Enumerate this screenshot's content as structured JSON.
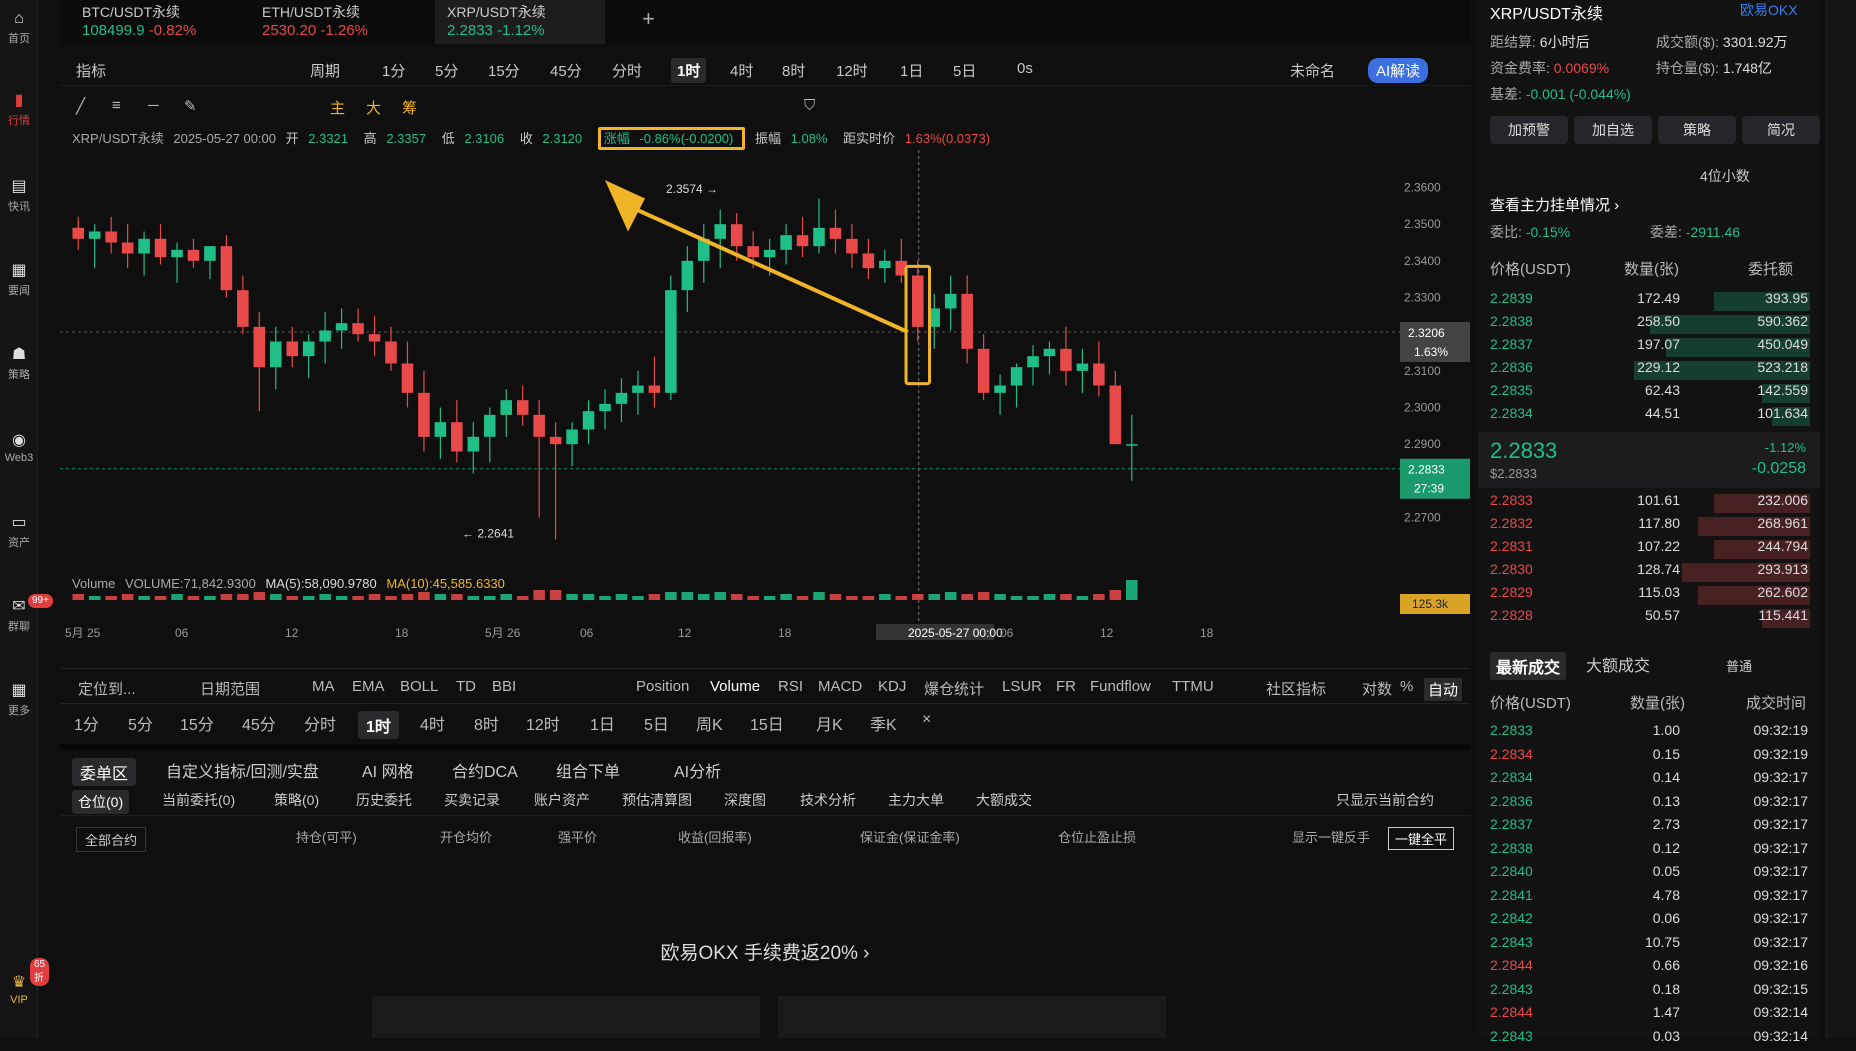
{
  "leftbar": {
    "items": [
      {
        "label": "首页",
        "icon": "home-icon"
      },
      {
        "label": "行情",
        "icon": "chart-bar-icon"
      },
      {
        "label": "快讯",
        "icon": "news-icon"
      },
      {
        "label": "要闻",
        "icon": "document-icon"
      },
      {
        "label": "策略",
        "icon": "robot-icon"
      },
      {
        "label": "Web3",
        "icon": "web3-icon"
      },
      {
        "label": "资产",
        "icon": "wallet-icon"
      },
      {
        "label": "群聊",
        "icon": "chat-icon"
      },
      {
        "label": "更多",
        "icon": "grid-icon"
      },
      {
        "label": "VIP",
        "icon": "vip-icon"
      }
    ],
    "chat_badge": "99+",
    "vip_badge": "65折"
  },
  "tabs": [
    {
      "name": "BTC/USDT永续",
      "price": "108499.9",
      "change": "-0.82%"
    },
    {
      "name": "ETH/USDT永续",
      "price": "2530.20",
      "change": "-1.26%"
    },
    {
      "name": "XRP/USDT永续",
      "price": "2.2833",
      "change": "-1.12%"
    }
  ],
  "add_tab": "+",
  "toolbar1": {
    "indicator": "指标",
    "period": "周期",
    "intervals": [
      "1分",
      "5分",
      "15分",
      "45分",
      "分时",
      "1时",
      "4时",
      "8时",
      "12时",
      "1日",
      "5日"
    ],
    "active_interval": "1时",
    "os": "0s",
    "unnamed": "未命名",
    "ai": "AI解读"
  },
  "toolbar2": {
    "labels": [
      "主",
      "大",
      "筹"
    ]
  },
  "chartinfo": {
    "symbol": "XRP/USDT永续",
    "datetime": "2025-05-27 00:00",
    "open_lbl": "开",
    "open": "2.3321",
    "high_lbl": "高",
    "high": "2.3357",
    "low_lbl": "低",
    "low": "2.3106",
    "close_lbl": "收",
    "close": "2.3120",
    "chg_lbl": "涨幅",
    "chg": "-0.86%(-0.0200)",
    "amp_lbl": "振幅",
    "amp": "1.08%",
    "dist_lbl": "距实时价",
    "dist": "1.63%(0.0373)"
  },
  "volume_info": {
    "label": "Volume",
    "volume": "VOLUME:71,842.9300",
    "ma5": "MA(5):58,090.9780",
    "ma10": "MA(10):45,585.6330"
  },
  "chart_data": {
    "type": "candlestick",
    "ylim": [
      2.26,
      2.37
    ],
    "yticks": [
      "2.3600",
      "2.3500",
      "2.3400",
      "2.3300",
      "2.3200",
      "2.3100",
      "2.3000",
      "2.2900",
      "2.2800",
      "2.2700"
    ],
    "xticks": [
      "5月 25",
      "06",
      "12",
      "18",
      "5月 26",
      "06",
      "12",
      "18",
      "2025-05-27 00:00",
      "06",
      "12",
      "18"
    ],
    "annotations": {
      "high": "2.3574",
      "low": "2.2641"
    },
    "crosshair_price": "2.3206",
    "crosshair_pct": "1.63%",
    "last_price": "2.2833",
    "countdown": "27:39",
    "volume_axis": "125.3k",
    "candles": [
      [
        2.349,
        2.352,
        2.343,
        2.346
      ],
      [
        2.346,
        2.35,
        2.338,
        2.348
      ],
      [
        2.348,
        2.352,
        2.342,
        2.345
      ],
      [
        2.345,
        2.35,
        2.338,
        2.342
      ],
      [
        2.342,
        2.348,
        2.336,
        2.346
      ],
      [
        2.346,
        2.35,
        2.339,
        2.341
      ],
      [
        2.341,
        2.345,
        2.334,
        2.343
      ],
      [
        2.343,
        2.346,
        2.338,
        2.34
      ],
      [
        2.34,
        2.344,
        2.335,
        2.344
      ],
      [
        2.344,
        2.347,
        2.33,
        2.332
      ],
      [
        2.332,
        2.336,
        2.32,
        2.322
      ],
      [
        2.322,
        2.326,
        2.299,
        2.311
      ],
      [
        2.311,
        2.322,
        2.305,
        2.318
      ],
      [
        2.318,
        2.322,
        2.311,
        2.314
      ],
      [
        2.314,
        2.32,
        2.308,
        2.318
      ],
      [
        2.318,
        2.326,
        2.312,
        2.321
      ],
      [
        2.321,
        2.327,
        2.316,
        2.323
      ],
      [
        2.323,
        2.327,
        2.318,
        2.32
      ],
      [
        2.32,
        2.325,
        2.314,
        2.318
      ],
      [
        2.318,
        2.322,
        2.31,
        2.312
      ],
      [
        2.312,
        2.318,
        2.3,
        2.304
      ],
      [
        2.304,
        2.31,
        2.288,
        2.292
      ],
      [
        2.292,
        2.3,
        2.286,
        2.296
      ],
      [
        2.296,
        2.302,
        2.285,
        2.288
      ],
      [
        2.288,
        2.296,
        2.282,
        2.292
      ],
      [
        2.292,
        2.3,
        2.285,
        2.298
      ],
      [
        2.298,
        2.305,
        2.292,
        2.302
      ],
      [
        2.302,
        2.306,
        2.295,
        2.298
      ],
      [
        2.298,
        2.302,
        2.27,
        2.292
      ],
      [
        2.292,
        2.296,
        2.264,
        2.29
      ],
      [
        2.29,
        2.296,
        2.284,
        2.294
      ],
      [
        2.294,
        2.302,
        2.29,
        2.299
      ],
      [
        2.299,
        2.305,
        2.294,
        2.301
      ],
      [
        2.301,
        2.308,
        2.296,
        2.304
      ],
      [
        2.304,
        2.31,
        2.298,
        2.306
      ],
      [
        2.306,
        2.314,
        2.3,
        2.304
      ],
      [
        2.304,
        2.336,
        2.302,
        2.332
      ],
      [
        2.332,
        2.344,
        2.326,
        2.34
      ],
      [
        2.34,
        2.35,
        2.334,
        2.346
      ],
      [
        2.346,
        2.354,
        2.338,
        2.35
      ],
      [
        2.35,
        2.353,
        2.34,
        2.344
      ],
      [
        2.344,
        2.348,
        2.338,
        2.341
      ],
      [
        2.341,
        2.346,
        2.336,
        2.343
      ],
      [
        2.343,
        2.35,
        2.339,
        2.347
      ],
      [
        2.347,
        2.352,
        2.341,
        2.344
      ],
      [
        2.344,
        2.357,
        2.342,
        2.349
      ],
      [
        2.349,
        2.354,
        2.342,
        2.346
      ],
      [
        2.346,
        2.35,
        2.338,
        2.342
      ],
      [
        2.342,
        2.346,
        2.335,
        2.338
      ],
      [
        2.338,
        2.343,
        2.334,
        2.34
      ],
      [
        2.34,
        2.346,
        2.334,
        2.336
      ],
      [
        2.336,
        2.34,
        2.318,
        2.322
      ],
      [
        2.322,
        2.331,
        2.316,
        2.327
      ],
      [
        2.327,
        2.336,
        2.321,
        2.331
      ],
      [
        2.331,
        2.336,
        2.312,
        2.316
      ],
      [
        2.316,
        2.32,
        2.302,
        2.304
      ],
      [
        2.304,
        2.309,
        2.298,
        2.306
      ],
      [
        2.306,
        2.312,
        2.3,
        2.311
      ],
      [
        2.311,
        2.317,
        2.306,
        2.314
      ],
      [
        2.314,
        2.318,
        2.309,
        2.316
      ],
      [
        2.316,
        2.322,
        2.306,
        2.31
      ],
      [
        2.31,
        2.316,
        2.304,
        2.312
      ],
      [
        2.312,
        2.318,
        2.303,
        2.306
      ],
      [
        2.306,
        2.31,
        2.295,
        2.29
      ],
      [
        2.29,
        2.298,
        2.28,
        2.29
      ]
    ],
    "volumes": [
      3,
      2,
      2,
      3,
      2,
      2,
      3,
      2,
      2,
      3,
      3,
      4,
      3,
      2,
      2,
      3,
      2,
      2,
      3,
      2,
      3,
      4,
      3,
      3,
      2,
      2,
      3,
      2,
      5,
      5,
      3,
      3,
      2,
      3,
      2,
      3,
      4,
      4,
      3,
      4,
      3,
      2,
      2,
      3,
      2,
      4,
      3,
      2,
      2,
      3,
      2,
      3,
      3,
      4,
      3,
      4,
      3,
      2,
      2,
      3,
      3,
      2,
      3,
      5,
      10
    ]
  },
  "tb_bottom1": {
    "locate": "定位到...",
    "range": "日期范围",
    "indicators": [
      "MA",
      "EMA",
      "BOLL",
      "TD",
      "BBI"
    ],
    "subs": [
      "Position",
      "Volume",
      "RSI",
      "MACD",
      "KDJ",
      "爆仓统计",
      "LSUR",
      "FR",
      "Fundflow",
      "TTMU"
    ],
    "community": "社区指标",
    "log": "对数",
    "pct": "%",
    "auto": "自动"
  },
  "tb_bottom2": {
    "intervals": [
      "1分",
      "5分",
      "15分",
      "45分",
      "分时",
      "1时",
      "4时",
      "8时",
      "12时",
      "1日",
      "5日",
      "周K",
      "15日",
      "月K",
      "季K"
    ],
    "active": "1时",
    "close": "×"
  },
  "panel_tabs": [
    "委单区",
    "自定义指标/回测/实盘",
    "AI 网格",
    "合约DCA",
    "组合下单",
    "AI分析"
  ],
  "panel_tabs2": [
    "仓位(0)",
    "当前委托(0)",
    "策略(0)",
    "历史委托",
    "买卖记录",
    "账户资产",
    "预估清算图",
    "深度图",
    "技术分析",
    "主力大单",
    "大额成交"
  ],
  "show_current": "只显示当前合约",
  "position_head": {
    "all_contracts": "全部合约",
    "cols": [
      "持仓(可平)",
      "开仓均价",
      "强平价",
      "收益(回报率)",
      "保证金(保证金率)",
      "仓位止盈止损"
    ],
    "show_reverse": "显示一键反手",
    "close_all": "一键全平"
  },
  "promo": "欧易OKX 手续费返20%",
  "right": {
    "symbol": "XRP/USDT永续",
    "exchange": "欧易OKX",
    "settle_lbl": "距结算:",
    "settle": "6小时后",
    "turnover_lbl": "成交额($):",
    "turnover": "3301.92万",
    "funding_lbl": "资金费率:",
    "funding": "0.0069%",
    "oi_lbl": "持仓量($):",
    "oi": "1.748亿",
    "basis_lbl": "基差:",
    "basis": "-0.001 (-0.044%)",
    "buttons": [
      "加预警",
      "加自选",
      "策略",
      "简况"
    ],
    "decimals": "4位小数",
    "whale": "查看主力挂单情况",
    "ratio_lbl": "委比:",
    "ratio": "-0.15%",
    "diff_lbl": "委差:",
    "diff": "-2911.46",
    "ob_head": [
      "价格(USDT)",
      "数量(张)",
      "委托额"
    ],
    "asks": [
      [
        "2.2839",
        "172.49",
        "393.95",
        0.3
      ],
      [
        "2.2838",
        "258.50",
        "590.362",
        0.5
      ],
      [
        "2.2837",
        "197.07",
        "450.049",
        0.45
      ],
      [
        "2.2836",
        "229.12",
        "523.218",
        0.55
      ],
      [
        "2.2835",
        "62.43",
        "142.559",
        0.15
      ],
      [
        "2.2834",
        "44.51",
        "101.634",
        0.12
      ]
    ],
    "mid_price": "2.2833",
    "mid_usd": "$2.2833",
    "mid_pct": "-1.12%",
    "mid_chg": "-0.0258",
    "bids": [
      [
        "2.2833",
        "101.61",
        "232.006",
        0.3
      ],
      [
        "2.2832",
        "117.80",
        "268.961",
        0.35
      ],
      [
        "2.2831",
        "107.22",
        "244.794",
        0.3
      ],
      [
        "2.2830",
        "128.74",
        "293.913",
        0.4
      ],
      [
        "2.2829",
        "115.03",
        "262.602",
        0.35
      ],
      [
        "2.2828",
        "50.57",
        "115.441",
        0.15
      ]
    ],
    "trade_tabs": [
      "最新成交",
      "大额成交"
    ],
    "normal": "普通",
    "tr_head": [
      "价格(USDT)",
      "数量(张)",
      "成交时间"
    ],
    "trades": [
      [
        "2.2833",
        "1.00",
        "09:32:19",
        "green"
      ],
      [
        "2.2834",
        "0.15",
        "09:32:19",
        "red"
      ],
      [
        "2.2834",
        "0.14",
        "09:32:17",
        "green"
      ],
      [
        "2.2836",
        "0.13",
        "09:32:17",
        "green"
      ],
      [
        "2.2837",
        "2.73",
        "09:32:17",
        "green"
      ],
      [
        "2.2838",
        "0.12",
        "09:32:17",
        "green"
      ],
      [
        "2.2840",
        "0.05",
        "09:32:17",
        "green"
      ],
      [
        "2.2841",
        "4.78",
        "09:32:17",
        "green"
      ],
      [
        "2.2842",
        "0.06",
        "09:32:17",
        "green"
      ],
      [
        "2.2843",
        "10.75",
        "09:32:17",
        "green"
      ],
      [
        "2.2844",
        "0.66",
        "09:32:16",
        "red"
      ],
      [
        "2.2843",
        "0.18",
        "09:32:15",
        "green"
      ],
      [
        "2.2844",
        "1.47",
        "09:32:14",
        "red"
      ],
      [
        "2.2843",
        "0.03",
        "09:32:14",
        "green"
      ]
    ]
  },
  "colors": {
    "up": "#1fbf87",
    "down": "#e84a4a",
    "accent": "#f0b429",
    "bg": "#0f0f10"
  }
}
